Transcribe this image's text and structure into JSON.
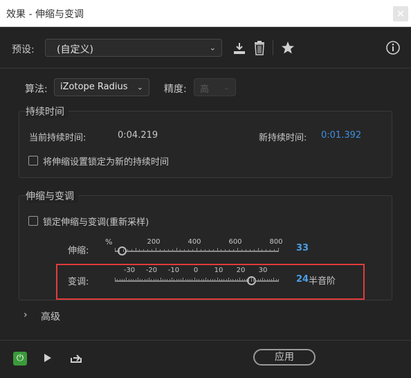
{
  "window": {
    "title": "效果 - 伸缩与变调",
    "close_glyph": "✕"
  },
  "preset": {
    "label": "预设:",
    "value": "(自定义)"
  },
  "toolbar": {
    "download_icon": "download-icon",
    "delete_icon": "trash-icon",
    "favorite_icon": "star-icon",
    "info_icon": "info-icon"
  },
  "algorithm": {
    "label": "算法:",
    "value": "iZotope Radius",
    "precision_label": "精度:",
    "precision_value": "高"
  },
  "duration": {
    "section_title": "持续时间",
    "current_label": "当前持续时间:",
    "current_value": "0:04.219",
    "new_label": "新持续时间:",
    "new_value": "0:01.392",
    "lock_label": "将伸缩设置锁定为新的持续时间"
  },
  "stretch_pitch": {
    "section_title": "伸缩与变调",
    "lock_label": "锁定伸缩与变调(重新采样)",
    "stretch": {
      "label": "伸缩:",
      "unit": "%",
      "ticks": [
        "200",
        "400",
        "600",
        "800"
      ],
      "value": "33",
      "value_num": 33,
      "min": 0,
      "max": 800
    },
    "pitch": {
      "label": "变调:",
      "ticks": [
        "-30",
        "-20",
        "-10",
        "0",
        "10",
        "20",
        "30"
      ],
      "value": "24",
      "value_num": 24,
      "unit": "半音阶",
      "min": -36,
      "max": 36
    }
  },
  "advanced": {
    "label": "高级"
  },
  "footer": {
    "apply_label": "应用"
  },
  "colors": {
    "accent_blue": "#4a9ee8",
    "highlight_red": "#e03c3c",
    "power_green": "#3a9a3a"
  }
}
